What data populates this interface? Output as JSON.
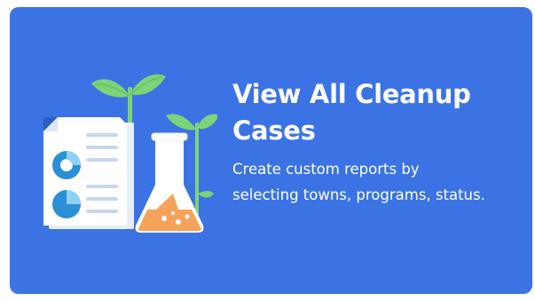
{
  "card": {
    "title": "View All Cleanup Cases",
    "description": "Create custom reports by selecting towns, programs, status.",
    "background_color": "#3b73e4",
    "text_color": "#ffffff"
  },
  "illustration": {
    "icons": [
      "report-document-icon",
      "pie-chart-icon",
      "lab-flask-icon",
      "plant-sprout-icon"
    ],
    "colors": {
      "leaf": "#7cd478",
      "stem": "#7cd478",
      "document": "#ffffff",
      "chart": "#2a8fd4",
      "flask_liquid": "#f5a35a"
    }
  }
}
